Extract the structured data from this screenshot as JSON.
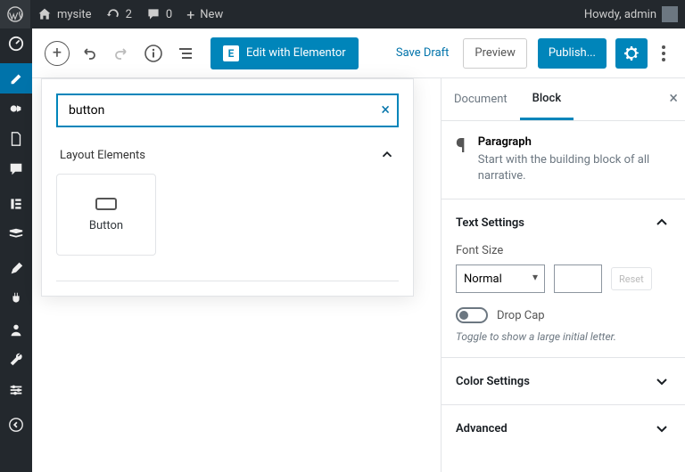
{
  "adminbar": {
    "site_name": "mysite",
    "update_count": "2",
    "comment_count": "0",
    "new_label": "New",
    "howdy": "Howdy, admin"
  },
  "toolbar": {
    "edit_elementor": "Edit with Elementor",
    "save_draft": "Save Draft",
    "preview": "Preview",
    "publish": "Publish..."
  },
  "inserter": {
    "search_value": "button",
    "category": "Layout Elements",
    "blocks": [
      {
        "label": "Button"
      }
    ]
  },
  "sidebar": {
    "tabs": {
      "document": "Document",
      "block": "Block"
    },
    "block_header": {
      "title": "Paragraph",
      "desc": "Start with the building block of all narrative."
    },
    "text_settings": {
      "title": "Text Settings",
      "font_size_label": "Font Size",
      "font_size_value": "Normal",
      "reset": "Reset",
      "drop_cap": "Drop Cap",
      "drop_cap_hint": "Toggle to show a large initial letter."
    },
    "color_settings": "Color Settings",
    "advanced": "Advanced"
  }
}
